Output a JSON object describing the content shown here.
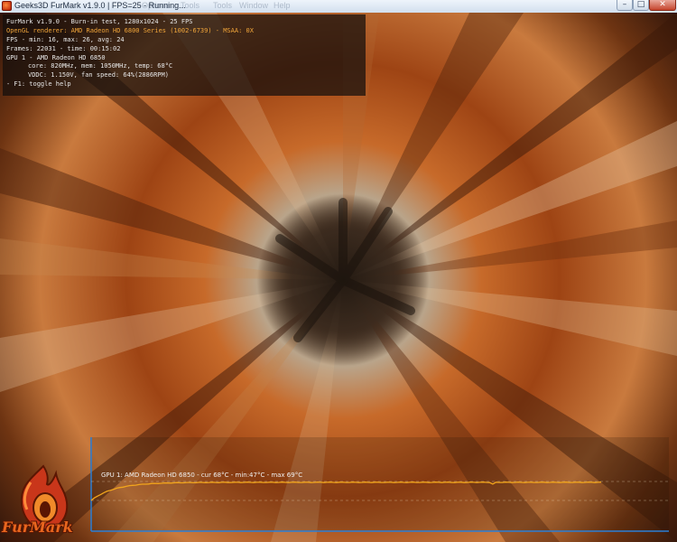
{
  "window": {
    "title": "Geeks3D FurMark v1.9.0 | FPS=25 - Running...",
    "ghost_menu": [
      "Options",
      "Tools",
      "Tools",
      "Window",
      "Help"
    ],
    "buttons": {
      "minimize": "–",
      "maximize": "□",
      "close": "✕"
    }
  },
  "overlay": {
    "line1": "FurMark v1.9.0 - Burn-in test, 1280x1024 - 25 FPS",
    "line2": "OpenGL renderer: AMD Radeon HD 6800 Series (1002-6739) - MSAA: 0X",
    "line3": "FPS - min: 16, max: 26, avg: 24",
    "line4": "Frames: 22031 - time: 00:15:02",
    "line5": "GPU 1 - AMD Radeon HD 6850",
    "line6": "core: 820MHz, mem: 1050MHz, temp: 68°C",
    "line7": "VDDC: 1.150V, fan speed: 64%(2886RPM)",
    "line8": "- F1: toggle help"
  },
  "graph": {
    "label": "GPU 1: AMD Radeon HD 6850 - cur 68°C - min:47°C - max 69°C",
    "line_color": "#f2a51c",
    "axis_color": "#2b7fd6",
    "temp_min": 47,
    "temp_max": 69,
    "temp_cur": 68
  },
  "logo": {
    "text": "FurMark"
  },
  "colors": {
    "title_bar": "#dbe6f3",
    "overlay_text": "#e7e7e7",
    "overlay_accent": "#f0a53a"
  }
}
